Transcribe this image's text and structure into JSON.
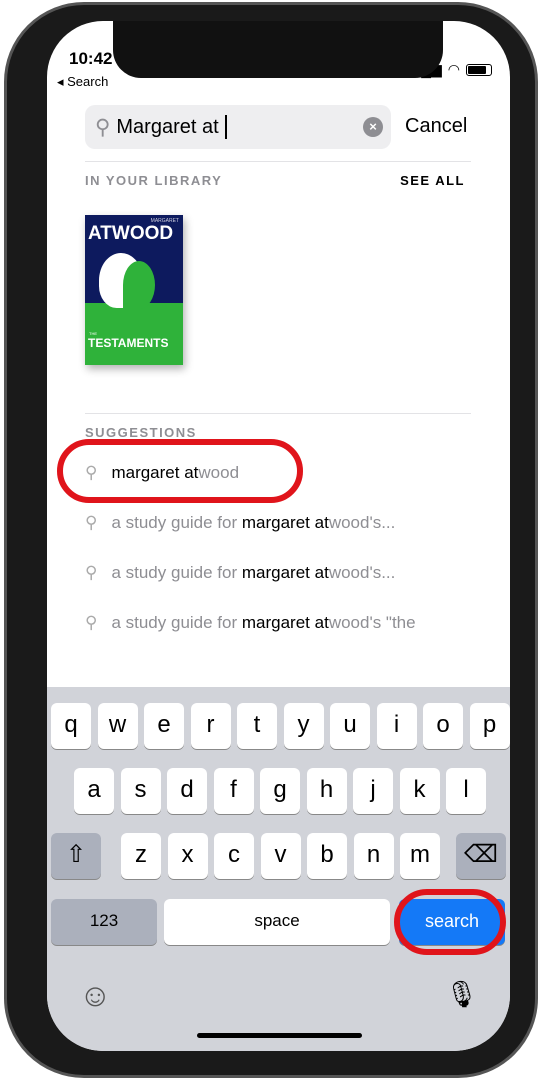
{
  "status": {
    "time": "10:42",
    "back_label": "Search"
  },
  "search": {
    "query": "Margaret at",
    "cancel_label": "Cancel"
  },
  "library": {
    "header": "IN YOUR LIBRARY",
    "see_all": "SEE ALL",
    "book": {
      "cover_author_first": "MARGARET",
      "cover_author_last": "ATWOOD",
      "cover_the": "THE",
      "cover_title": "TESTAMENTS"
    }
  },
  "suggestions": {
    "header": "SUGGESTIONS",
    "items": [
      {
        "prefix": "",
        "bold": "margaret at",
        "rest": "wood"
      },
      {
        "prefix": "a study guide for ",
        "bold": "margaret at",
        "rest": "wood's..."
      },
      {
        "prefix": "a study guide for ",
        "bold": "margaret at",
        "rest": "wood's..."
      },
      {
        "prefix": "a study guide for ",
        "bold": "margaret at",
        "rest": "wood's \"the"
      }
    ]
  },
  "keyboard": {
    "row1": [
      "q",
      "w",
      "e",
      "r",
      "t",
      "y",
      "u",
      "i",
      "o",
      "p"
    ],
    "row2": [
      "a",
      "s",
      "d",
      "f",
      "g",
      "h",
      "j",
      "k",
      "l"
    ],
    "row3": [
      "z",
      "x",
      "c",
      "v",
      "b",
      "n",
      "m"
    ],
    "numbers": "123",
    "space": "space",
    "search": "search",
    "shift": "⇧",
    "delete": "⌫",
    "emoji": "☺",
    "mic": "🎙"
  },
  "colors": {
    "accent": "#1479f7",
    "highlight_ring": "#e0141b"
  }
}
